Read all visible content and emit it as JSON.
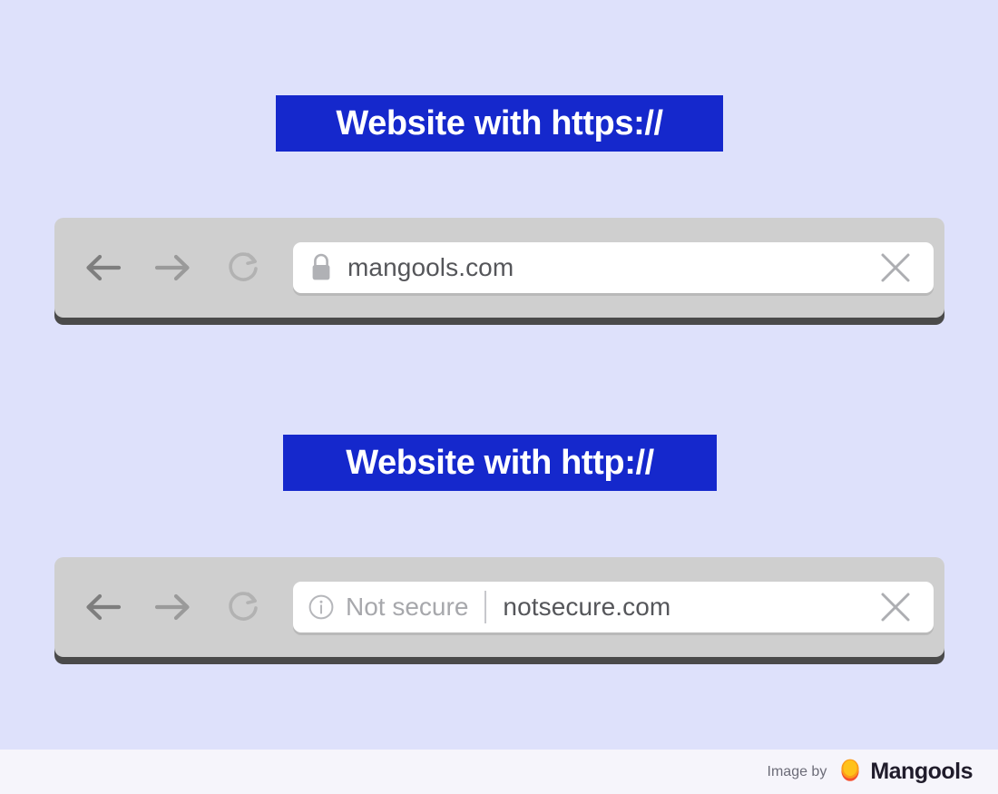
{
  "theme": {
    "page_background": "#dee1fb",
    "footer_background": "#f6f5fb",
    "banner_blue": "#1528cc",
    "banner_text_color": "#ffffff",
    "browser_bar_gray": "#cfcfcf",
    "browser_bar_shadow": "#4a4a4a",
    "url_field_white": "#ffffff",
    "url_text_gray": "#55565a",
    "muted_gray": "#a7a8ac",
    "logo_orange": "#fb9a1a",
    "logo_red": "#f5502f"
  },
  "sections": [
    {
      "id": "https",
      "banner_label": "Website with https://",
      "browser": {
        "back_icon": "arrow-left-icon",
        "forward_icon": "arrow-right-icon",
        "reload_icon": "reload-icon",
        "security_icon": "lock-icon",
        "security_label": "",
        "url": "mangools.com",
        "close_icon": "close-icon"
      }
    },
    {
      "id": "http",
      "banner_label": "Website with http://",
      "browser": {
        "back_icon": "arrow-left-icon",
        "forward_icon": "arrow-right-icon",
        "reload_icon": "reload-icon",
        "security_icon": "info-circle-icon",
        "security_label": "Not secure",
        "url": "notsecure.com",
        "close_icon": "close-icon"
      }
    }
  ],
  "footer": {
    "credit_prefix": "Image by",
    "brand_name": "Mangools",
    "brand_logo_icon": "mangools-circle-logo"
  }
}
